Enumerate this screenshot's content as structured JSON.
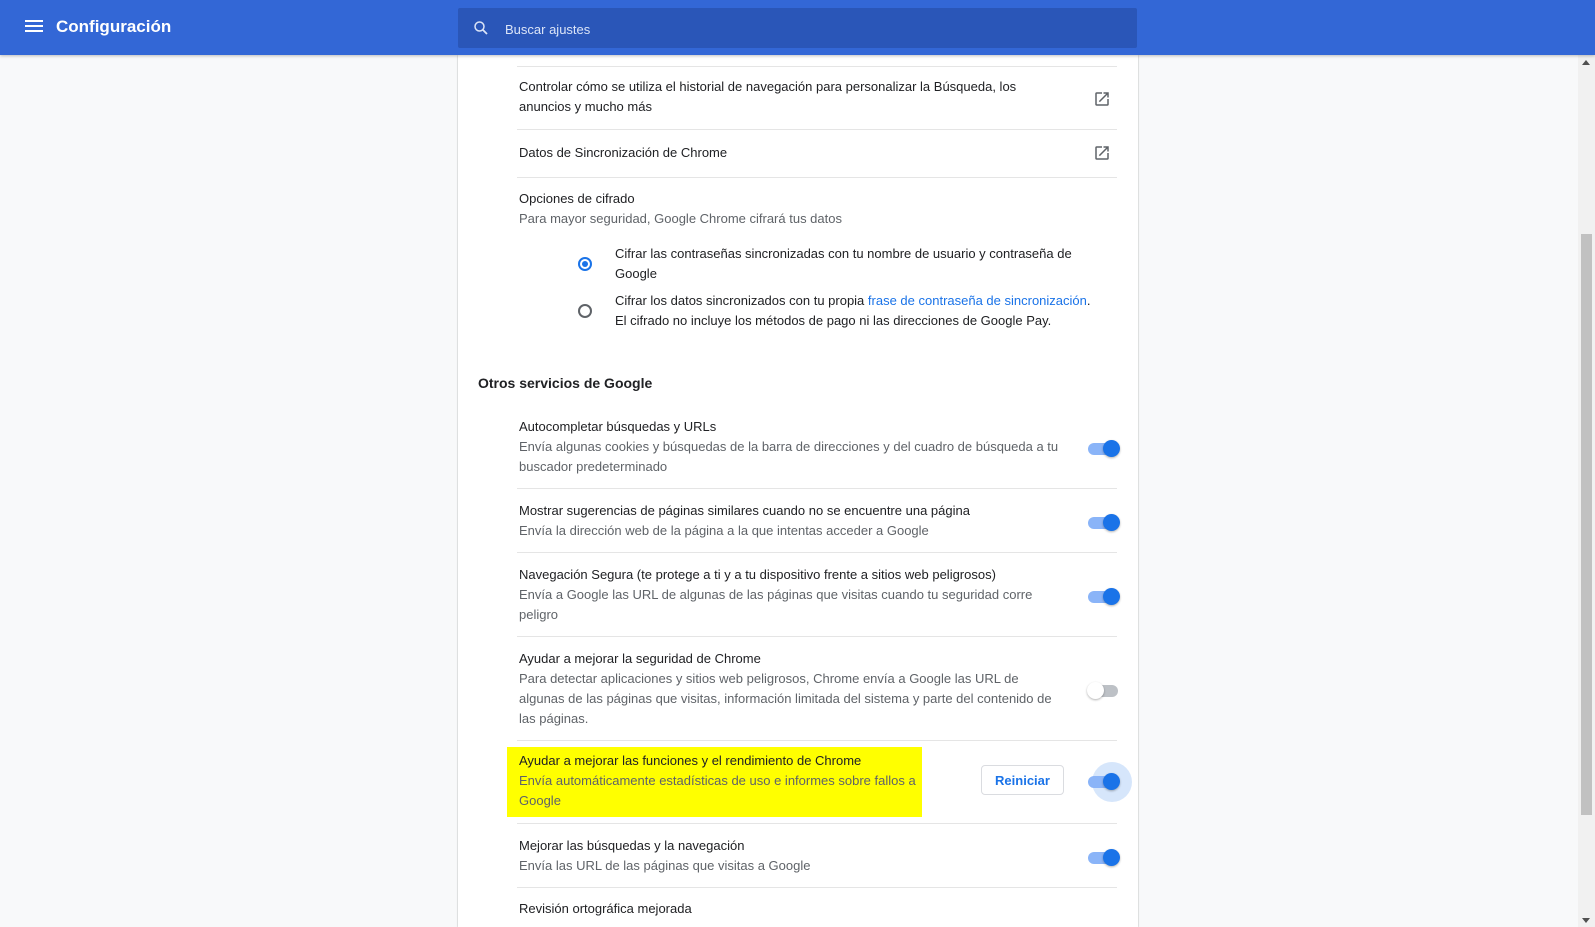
{
  "header": {
    "title": "Configuración",
    "search_placeholder": "Buscar ajustes"
  },
  "sync": {
    "history_control": "Controlar cómo se utiliza el historial de navegación para personalizar la Búsqueda, los anuncios y mucho más",
    "chrome_sync_data": "Datos de Sincronización de Chrome",
    "encryption_title": "Opciones de cifrado",
    "encryption_desc": "Para mayor seguridad, Google Chrome cifrará tus datos",
    "option1": "Cifrar las contraseñas sincronizadas con tu nombre de usuario y contraseña de Google",
    "option2_pre": "Cifrar los datos sincronizados con tu propia ",
    "option2_link": "frase de contraseña de sincronización",
    "option2_post": ".",
    "option2_line2": "El cifrado no incluye los métodos de pago ni las direcciones de Google Pay.",
    "selected_option": 1
  },
  "other_services": {
    "title": "Otros servicios de Google",
    "items": [
      {
        "title": "Autocompletar búsquedas y URLs",
        "desc": "Envía algunas cookies y búsquedas de la barra de direcciones y del cuadro de búsqueda a tu buscador predeterminado",
        "enabled": true
      },
      {
        "title": "Mostrar sugerencias de páginas similares cuando no se encuentre una página",
        "desc": "Envía la dirección web de la página a la que intentas acceder a Google",
        "enabled": true
      },
      {
        "title": "Navegación Segura (te protege a ti y a tu dispositivo frente a sitios web peligrosos)",
        "desc": "Envía a Google las URL de algunas de las páginas que visitas cuando tu seguridad corre peligro",
        "enabled": true
      },
      {
        "title": "Ayudar a mejorar la seguridad de Chrome",
        "desc": "Para detectar aplicaciones y sitios web peligrosos, Chrome envía a Google las URL de algunas de las páginas que visitas, información limitada del sistema y parte del contenido de las páginas.",
        "enabled": false
      },
      {
        "title": "Ayudar a mejorar las funciones y el rendimiento de Chrome",
        "desc": "Envía automáticamente estadísticas de uso e informes sobre fallos a Google",
        "enabled": true,
        "button": "Reiniciar"
      },
      {
        "title": "Mejorar las búsquedas y la navegación",
        "desc": "Envía las URL de las páginas que visitas a Google",
        "enabled": true
      },
      {
        "title": "Revisión ortográfica mejorada"
      }
    ]
  },
  "colors": {
    "header_bg": "#3367d6",
    "accent": "#1a73e8",
    "highlight": "#ffff00"
  }
}
